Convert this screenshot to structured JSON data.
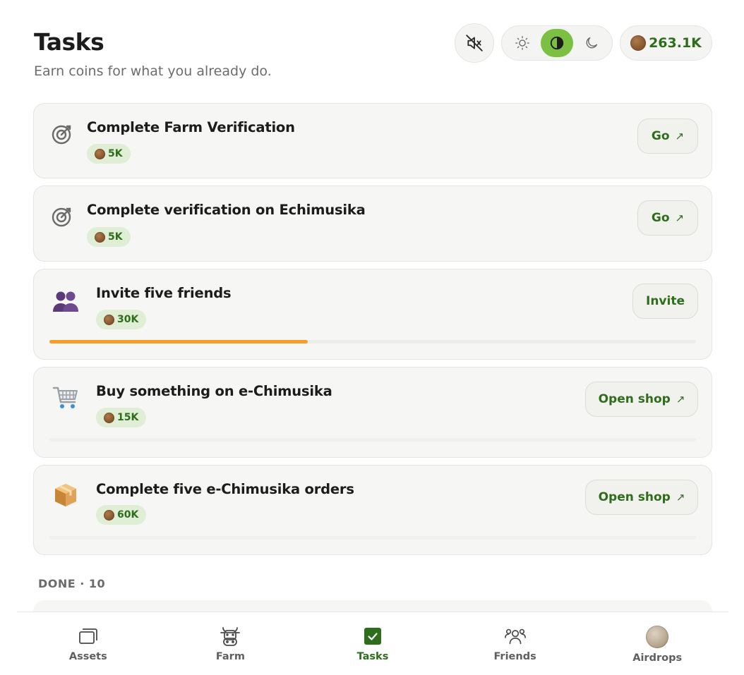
{
  "header": {
    "title": "Tasks",
    "subtitle": "Earn coins for what you already do.",
    "balance": "263.1K"
  },
  "theme": {
    "options": [
      "light",
      "contrast",
      "dark"
    ],
    "selected": "contrast"
  },
  "colors": {
    "accent": "#7cc043",
    "brand_text": "#2e6d1c",
    "progress": "#f4a028",
    "reward_bg": "#dfeed4"
  },
  "tasks": [
    {
      "title": "Complete Farm Verification",
      "reward": "5K",
      "action": "Go",
      "icon": "target-icon"
    },
    {
      "title": "Complete verification on Echimusika",
      "reward": "5K",
      "action": "Go",
      "icon": "target-icon"
    },
    {
      "title": "Invite five friends",
      "reward": "30K",
      "action": "Invite",
      "icon": "friends-icon",
      "progress": 0.4
    },
    {
      "title": "Buy something on e-Chimusika",
      "reward": "15K",
      "action": "Open shop",
      "icon": "cart-icon"
    },
    {
      "title": "Complete five e-Chimusika orders",
      "reward": "60K",
      "action": "Open shop",
      "icon": "package-icon"
    }
  ],
  "done": {
    "label": "DONE · 10"
  },
  "nav": {
    "items": [
      {
        "label": "Assets",
        "icon": "assets-icon"
      },
      {
        "label": "Farm",
        "icon": "cow-icon"
      },
      {
        "label": "Tasks",
        "icon": "check-square-icon",
        "active": true
      },
      {
        "label": "Friends",
        "icon": "friends-outline-icon"
      },
      {
        "label": "Airdrops",
        "icon": "coin-avatar-icon"
      }
    ]
  }
}
